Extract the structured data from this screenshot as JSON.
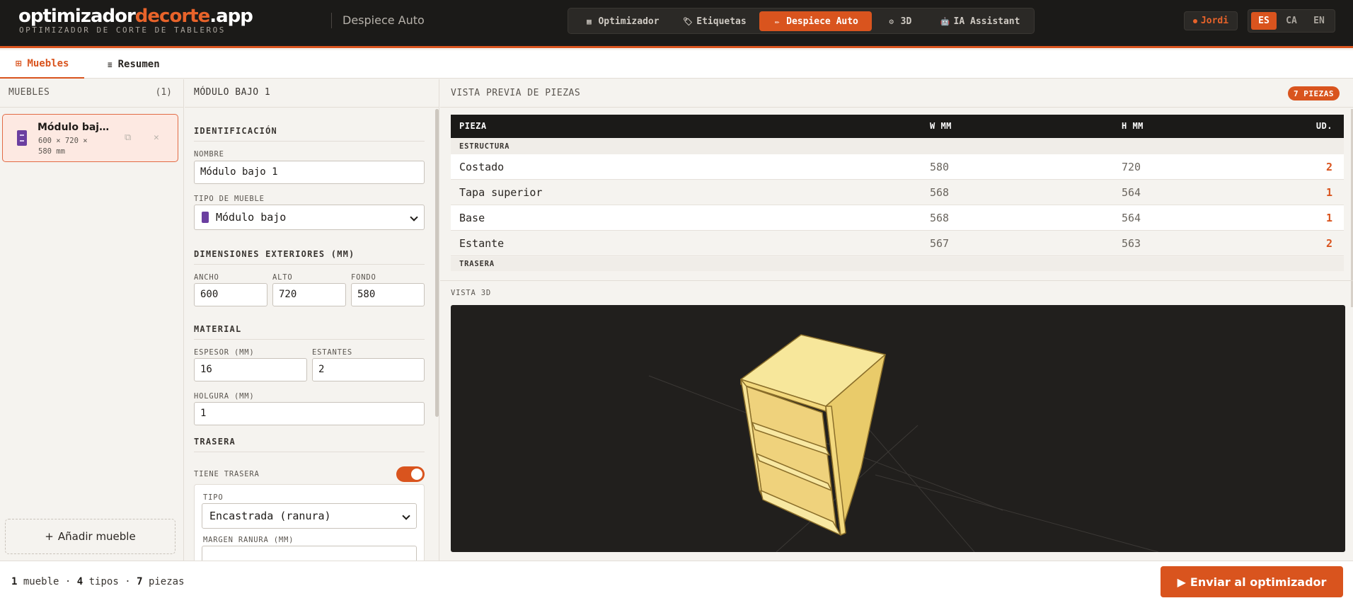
{
  "brand": {
    "logo_main": "optimizador",
    "logo_accent": "decorte",
    "logo_tld": ".app",
    "tagline": "OPTIMIZADOR DE CORTE DE TABLEROS",
    "section": "Despiece Auto"
  },
  "nav": {
    "items": [
      {
        "label": "Optimizador",
        "icon": "grid-icon",
        "glyph": "▦"
      },
      {
        "label": "Etiquetas",
        "icon": "tag-icon",
        "glyph": "🏷"
      },
      {
        "label": "Despiece Auto",
        "icon": "pencil-icon",
        "glyph": "✏"
      },
      {
        "label": "3D",
        "icon": "gear-icon",
        "glyph": "⚙"
      },
      {
        "label": "IA Assistant",
        "icon": "robot-icon",
        "glyph": "🤖"
      }
    ],
    "active": "Despiece Auto"
  },
  "user": {
    "name": "Jordi"
  },
  "languages": [
    "ES",
    "CA",
    "EN"
  ],
  "active_language": "ES",
  "tabs": [
    {
      "label": "Muebles",
      "icon": "grid-icon",
      "glyph": "⊞"
    },
    {
      "label": "Resumen",
      "icon": "list-icon",
      "glyph": "≡"
    }
  ],
  "left": {
    "title": "MUEBLES",
    "count": "(1)",
    "items": [
      {
        "name": "Módulo baj…",
        "dims": "600 × 720 × 580 mm",
        "icon": "cabinet-icon"
      }
    ],
    "add_label": "Añadir mueble"
  },
  "form": {
    "title": "MÓDULO BAJO 1",
    "identificacion": {
      "section": "IDENTIFICACIÓN",
      "nombre_label": "NOMBRE",
      "nombre_value": "Módulo bajo 1",
      "tipo_label": "TIPO DE MUEBLE",
      "tipo_value": "Módulo bajo"
    },
    "dimensiones": {
      "section": "DIMENSIONES EXTERIORES (MM)",
      "ancho_label": "ANCHO",
      "ancho_value": "600",
      "alto_label": "ALTO",
      "alto_value": "720",
      "fondo_label": "FONDO",
      "fondo_value": "580"
    },
    "material": {
      "section": "MATERIAL",
      "espesor_label": "ESPESOR (MM)",
      "espesor_value": "16",
      "estantes_label": "ESTANTES",
      "estantes_value": "2",
      "holgura_label": "HOLGURA (MM)",
      "holgura_value": "1"
    },
    "trasera": {
      "section": "TRASERA",
      "tiene_label": "TIENE TRASERA",
      "tiene_value": true,
      "tipo_label": "TIPO",
      "tipo_value": "Encastrada (ranura)",
      "margen_label": "MARGEN RANURA (MM)"
    }
  },
  "preview": {
    "title": "VISTA PREVIA DE PIEZAS",
    "badge": "7 PIEZAS",
    "columns": [
      "PIEZA",
      "W MM",
      "H MM",
      "UD."
    ],
    "groups": [
      {
        "name": "ESTRUCTURA",
        "rows": [
          {
            "pieza": "Costado",
            "w": "580",
            "h": "720",
            "ud": "2"
          },
          {
            "pieza": "Tapa superior",
            "w": "568",
            "h": "564",
            "ud": "1"
          },
          {
            "pieza": "Base",
            "w": "568",
            "h": "564",
            "ud": "1"
          },
          {
            "pieza": "Estante",
            "w": "567",
            "h": "563",
            "ud": "2"
          }
        ]
      },
      {
        "name": "TRASERA",
        "rows": []
      }
    ],
    "view3d_label": "VISTA 3D"
  },
  "footer": {
    "muebles_count": "1",
    "muebles_label": "mueble",
    "tipos_count": "4",
    "tipos_label": "tipos",
    "piezas_count": "7",
    "piezas_label": "piezas",
    "send_label": "Enviar al optimizador"
  },
  "colors": {
    "accent": "#d9541e",
    "topbar": "#1b1a18",
    "wood": "#f4df86"
  }
}
